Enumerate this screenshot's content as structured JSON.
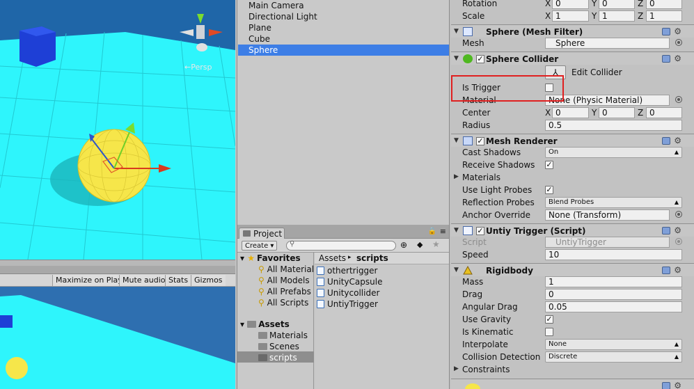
{
  "scene": {
    "persp_label": "←Persp"
  },
  "game_toolbar": {
    "maximize": "Maximize on Play",
    "mute": "Mute audio",
    "stats": "Stats",
    "gizmos": "Gizmos"
  },
  "hierarchy": {
    "items": [
      "Main Camera",
      "Directional Light",
      "Plane",
      "Cube",
      "Sphere"
    ],
    "selected": "Sphere"
  },
  "project": {
    "tab_label": "Project",
    "create_label": "Create",
    "favorites_label": "Favorites",
    "favorites": [
      "All Material",
      "All Models",
      "All Prefabs",
      "All Scripts"
    ],
    "assets_label": "Assets",
    "folders": [
      "Materials",
      "Scenes",
      "scripts"
    ],
    "breadcrumb": {
      "root": "Assets",
      "current": "scripts"
    },
    "files": [
      "othertrigger",
      "UnityCapsule",
      "Unitycollider",
      "UntiyTrigger"
    ]
  },
  "inspector": {
    "transform": {
      "rotation_label": "Rotation",
      "rotation": {
        "x": "0",
        "y": "0",
        "z": "0"
      },
      "scale_label": "Scale",
      "scale": {
        "x": "1",
        "y": "1",
        "z": "1"
      }
    },
    "mesh_filter": {
      "title": "Sphere (Mesh Filter)",
      "mesh_label": "Mesh",
      "mesh_value": "Sphere"
    },
    "sphere_collider": {
      "title": "Sphere Collider",
      "edit_label": "Edit Collider",
      "is_trigger_label": "Is Trigger",
      "is_trigger": false,
      "material_label": "Material",
      "material_value": "None (Physic Material)",
      "center_label": "Center",
      "center": {
        "x": "0",
        "y": "0",
        "z": "0"
      },
      "radius_label": "Radius",
      "radius": "0.5"
    },
    "mesh_renderer": {
      "title": "Mesh Renderer",
      "cast_shadows_label": "Cast Shadows",
      "cast_shadows": "On",
      "receive_shadows_label": "Receive Shadows",
      "receive_shadows": true,
      "materials_label": "Materials",
      "light_probes_label": "Use Light Probes",
      "light_probes": true,
      "reflection_label": "Reflection Probes",
      "reflection": "Blend Probes",
      "anchor_label": "Anchor Override",
      "anchor": "None (Transform)"
    },
    "script": {
      "title": "Untiy Trigger (Script)",
      "script_label": "Script",
      "script_value": "UntiyTrigger",
      "speed_label": "Speed",
      "speed": "10"
    },
    "rigidbody": {
      "title": "Rigidbody",
      "mass_label": "Mass",
      "mass": "1",
      "drag_label": "Drag",
      "drag": "0",
      "angular_label": "Angular Drag",
      "angular": "0.05",
      "gravity_label": "Use Gravity",
      "gravity": true,
      "kinematic_label": "Is Kinematic",
      "kinematic": false,
      "interpolate_label": "Interpolate",
      "interpolate": "None",
      "collision_label": "Collision Detection",
      "collision": "Discrete",
      "constraints_label": "Constraints"
    },
    "axis": {
      "x": "X",
      "y": "Y",
      "z": "Z"
    }
  },
  "colors": {
    "selection": "#3d7ee6",
    "highlight_box": "#e02020",
    "plane": "#2ef5fc",
    "sphere": "#f6e64a",
    "cube": "#1e3fd6"
  }
}
